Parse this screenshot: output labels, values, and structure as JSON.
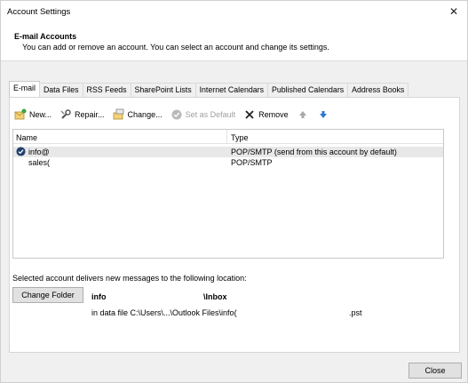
{
  "window": {
    "title": "Account Settings"
  },
  "header": {
    "title": "E-mail Accounts",
    "description": "You can add or remove an account. You can select an account and change its settings."
  },
  "tabs": [
    {
      "label": "E-mail",
      "active": true
    },
    {
      "label": "Data Files"
    },
    {
      "label": "RSS Feeds"
    },
    {
      "label": "SharePoint Lists"
    },
    {
      "label": "Internet Calendars"
    },
    {
      "label": "Published Calendars"
    },
    {
      "label": "Address Books"
    }
  ],
  "toolbar": {
    "new": "New...",
    "repair": "Repair...",
    "change": "Change...",
    "set_default": "Set as Default",
    "remove": "Remove"
  },
  "list": {
    "headers": {
      "name": "Name",
      "type": "Type"
    },
    "rows": [
      {
        "name": "info@",
        "type": "POP/SMTP (send from this account by default)",
        "selected": true,
        "default": true
      },
      {
        "name": "sales(",
        "type": "POP/SMTP",
        "selected": false,
        "default": false
      }
    ]
  },
  "delivery": {
    "label": "Selected account delivers new messages to the following location:",
    "change_folder": "Change Folder",
    "account": "info",
    "folder": "\\Inbox",
    "data_file": "in data file C:\\Users\\...\\Outlook Files\\info(",
    "data_file_ext": ".pst"
  },
  "footer": {
    "close": "Close"
  },
  "colors": {
    "accent": "#2f78d1",
    "selected_row": "#e8e8e8"
  }
}
